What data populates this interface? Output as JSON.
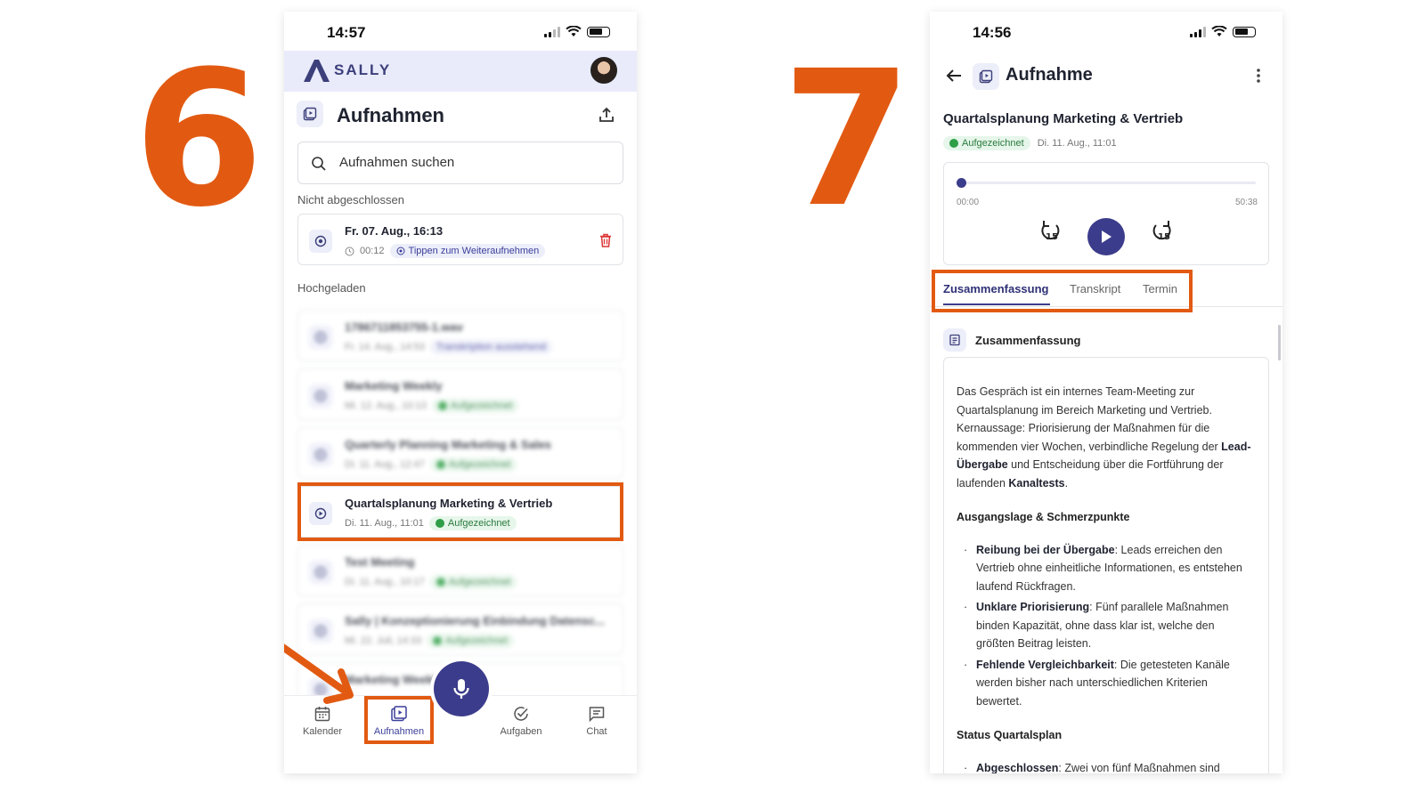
{
  "steps": {
    "left": "6",
    "right": "7"
  },
  "colors": {
    "accent": "#e25a12",
    "primary": "#3c3c8c",
    "appbar": "#e9ebfb"
  },
  "phone1": {
    "time": "14:57",
    "brand": "SALLY",
    "title": "Aufnahmen",
    "search_placeholder": "Aufnahmen suchen",
    "section_unfinished": "Nicht abgeschlossen",
    "unfinished": {
      "title": "Fr. 07. Aug., 16:13",
      "duration": "00:12",
      "badge": "Tippen zum Weiteraufnehmen"
    },
    "section_uploaded": "Hochgeladen",
    "recordings": [
      {
        "title": "1786711853755-1.wav",
        "date": "Fr. 14. Aug., 14:53",
        "badge": "Transkription ausstehend"
      },
      {
        "title": "Marketing Weekly",
        "date": "Mi. 12. Aug., 10:13",
        "badge": "Aufgezeichnet"
      },
      {
        "title": "Quarterly Planning Marketing & Sales",
        "date": "Di. 11. Aug., 12:47",
        "badge": "Aufgezeichnet"
      },
      {
        "title": "Quartalsplanung Marketing & Vertrieb",
        "date": "Di. 11. Aug., 11:01",
        "badge": "Aufgezeichnet"
      },
      {
        "title": "Test Meeting",
        "date": "Di. 11. Aug., 10:17",
        "badge": "Aufgezeichnet"
      },
      {
        "title": "Sally | Konzeptionierung Einbindung Datensc...",
        "date": "Mi. 22. Juli, 14:33",
        "badge": "Aufgezeichnet"
      },
      {
        "title": "Marketing Weekly",
        "date": "",
        "badge": ""
      }
    ],
    "nav": [
      {
        "label": "Kalender",
        "icon": "calendar-icon"
      },
      {
        "label": "Aufnahmen",
        "icon": "recordings-icon"
      },
      {
        "label": "Aufgaben",
        "icon": "check-circle-icon"
      },
      {
        "label": "Chat",
        "icon": "chat-icon"
      }
    ]
  },
  "phone2": {
    "time": "14:56",
    "title": "Aufnahme",
    "recording_title": "Quartalsplanung Marketing & Vertrieb",
    "status": "Aufgezeichnet",
    "date": "Di. 11. Aug., 11:01",
    "player": {
      "current": "00:00",
      "total": "50:38",
      "progress": 0
    },
    "tabs": [
      "Zusammenfassung",
      "Transkript",
      "Termin"
    ],
    "summary_heading": "Zusammenfassung",
    "summary": {
      "intro_1": "Das Gespräch ist ein internes Team-Meeting zur Quartalsplanung im Bereich Marketing und Vertrieb. Kernaussage: Priorisierung der Maßnahmen für die kommenden vier Wochen, verbindliche Regelung der ",
      "intro_b1": "Lead-Übergabe",
      "intro_2": " und Entscheidung über die Fortführung der laufenden ",
      "intro_b2": "Kanaltests",
      "intro_3": ".",
      "section1": "Ausgangslage & Schmerzpunkte",
      "bullets": [
        {
          "bold": "Reibung bei der Übergabe",
          "text": ": Leads erreichen den Vertrieb ohne einheitliche Informationen, es entstehen laufend Rückfragen."
        },
        {
          "bold": "Unklare Priorisierung",
          "text": ": Fünf parallele Maßnahmen binden Kapazität, ohne dass klar ist, welche den größten Beitrag leisten."
        },
        {
          "bold": "Fehlende Vergleichbarkeit",
          "text": ": Die getesteten Kanäle werden bisher nach unterschiedlichen Kriterien bewertet."
        }
      ],
      "section2": "Status Quartalsplan",
      "bullets2": [
        {
          "bold": "Abgeschlossen",
          "text": ": Zwei von fünf Maßnahmen sind"
        }
      ]
    }
  }
}
